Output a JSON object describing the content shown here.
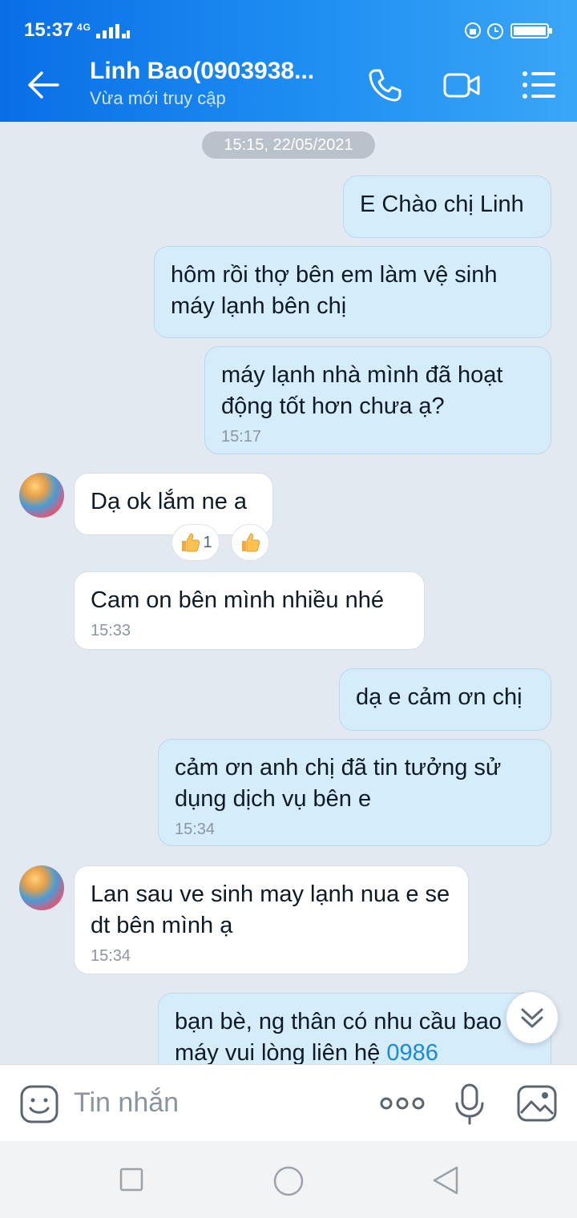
{
  "status_bar": {
    "time": "15:37",
    "network": "4G"
  },
  "header": {
    "contact_name": "Linh Bao(0903938...",
    "presence": "Vừa mới truy cập"
  },
  "chat": {
    "date_divider": "15:15, 22/05/2021",
    "messages": [
      {
        "direction": "out",
        "text": "E Chào chị Linh"
      },
      {
        "direction": "out",
        "text": "hôm rồi thợ bên em làm vệ sinh máy lạnh bên chị"
      },
      {
        "direction": "out",
        "text": "máy lạnh nhà mình đã hoạt động tốt hơn chưa ạ?",
        "time": "15:17"
      },
      {
        "direction": "in",
        "text": "Dạ ok lắm ne a",
        "reaction_count": "1"
      },
      {
        "direction": "in",
        "text": "Cam on bên mình nhiều nhé",
        "time": "15:33"
      },
      {
        "direction": "out",
        "text": "dạ e cảm ơn chị"
      },
      {
        "direction": "out",
        "text": "cảm ơn anh chị đã tin tưởng sử dụng dịch vụ bên e",
        "time": "15:34"
      },
      {
        "direction": "in",
        "text": "Lan sau ve sinh may lạnh nua e se dt bên mình ạ",
        "time": "15:34"
      },
      {
        "direction": "out",
        "text": "bạn bè, ng thân có nhu cầu bao trì máy vui lòng liên hệ",
        "phone_link": "0986"
      }
    ]
  },
  "input": {
    "placeholder": "Tin nhắn"
  },
  "colors": {
    "header_start": "#0a6ee6",
    "header_end": "#3aa6f7",
    "outgoing_bubble": "#d5ecfb",
    "incoming_bubble": "#ffffff",
    "link": "#1a8ad9"
  }
}
